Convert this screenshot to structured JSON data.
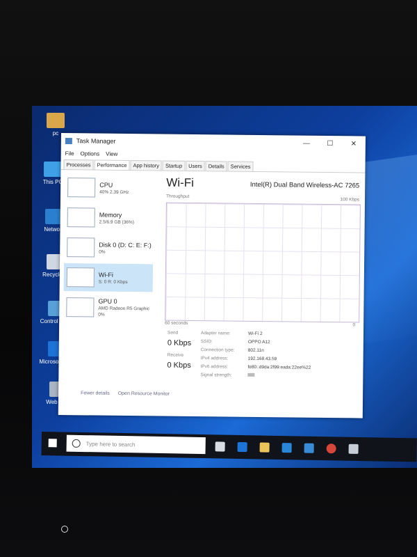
{
  "desktop": {
    "icons": [
      {
        "label": "pc"
      },
      {
        "label": "This PC"
      },
      {
        "label": "Network"
      },
      {
        "label": "Recycle Bi"
      },
      {
        "label": "Control Panel"
      },
      {
        "label": "Microsof Edge"
      },
      {
        "label": "Web Cam"
      }
    ]
  },
  "window": {
    "title": "Task Manager",
    "minimize": "—",
    "maximize": "☐",
    "close": "✕",
    "menu": [
      "File",
      "Options",
      "View"
    ],
    "tabs": [
      "Processes",
      "Performance",
      "App history",
      "Startup",
      "Users",
      "Details",
      "Services"
    ],
    "active_tab": "Performance"
  },
  "left_panel": [
    {
      "name": "CPU",
      "value": "40%  2.39 GHz"
    },
    {
      "name": "Memory",
      "value": "2.5/6.9 GB (36%)"
    },
    {
      "name": "Disk 0 (D: C: E: F:)",
      "value": "0%"
    },
    {
      "name": "Wi-Fi",
      "value": "S: 0   R: 0 Kbps",
      "selected": true
    },
    {
      "name": "GPU 0",
      "value": "AMD Radeon R5 Graphic",
      "value2": "0%"
    }
  ],
  "main": {
    "title": "Wi-Fi",
    "device": "Intel(R) Dual Band Wireless-AC 7265",
    "graph_label": "Throughput",
    "graph_max": "100 Kbps",
    "time_label": "60 seconds",
    "zero": "0",
    "send_label": "Send",
    "send_value": "0 Kbps",
    "receive_label": "Receive",
    "receive_value": "0 Kbps",
    "details": [
      {
        "k": "Adapter name:",
        "v": "Wi-Fi 2"
      },
      {
        "k": "SSID:",
        "v": "OPPO A12"
      },
      {
        "k": "Connection type:",
        "v": "802.11n"
      },
      {
        "k": "IPv4 address:",
        "v": "192.168.43.59"
      },
      {
        "k": "IPv6 address:",
        "v": "fe80::d9da:2f99:eada:22ee%22"
      },
      {
        "k": "Signal strength:",
        "v": ""
      }
    ]
  },
  "footer": {
    "fewer": "Fewer details",
    "monitor": "Open Resource Monitor"
  },
  "taskbar": {
    "search_placeholder": "Type here to search"
  }
}
